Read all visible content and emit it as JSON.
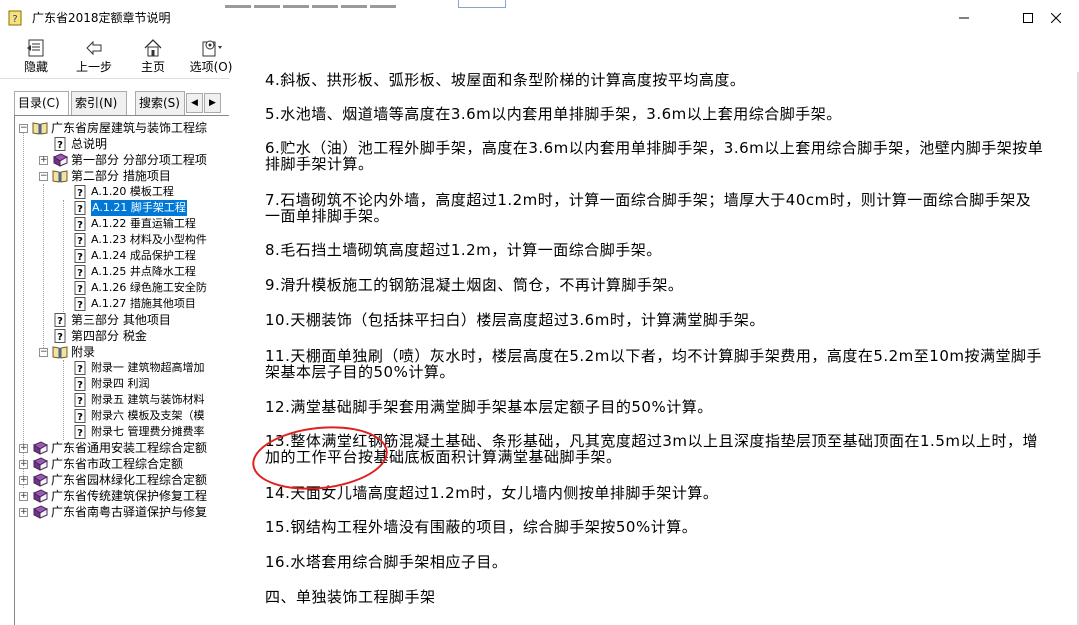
{
  "window": {
    "title": "广东省2018定额章节说明",
    "controls": {
      "minimize": "—",
      "maximize": "☐",
      "close": "✕"
    }
  },
  "toolbar": {
    "buttons": [
      {
        "label": "隐藏",
        "icon": "hide-panel-icon"
      },
      {
        "label": "上一步",
        "icon": "back-arrow-icon"
      },
      {
        "label": "主页",
        "icon": "home-icon"
      },
      {
        "label": "选项(O)",
        "icon": "options-icon"
      }
    ]
  },
  "tabs": [
    {
      "label": "目录(C)",
      "active": true
    },
    {
      "label": "索引(N)",
      "active": false
    },
    {
      "label": "搜索(S)",
      "active": false
    }
  ],
  "tree": [
    {
      "label": "广东省房屋建筑与装饰工程综",
      "expander": "−",
      "icon": "open-book-icon"
    },
    {
      "label": "总说明",
      "icon": "help-page-icon"
    },
    {
      "label": "第一部分 分部分项工程项",
      "expander": "+",
      "icon": "closed-book-icon"
    },
    {
      "label": "第二部分 措施项目",
      "expander": "−",
      "icon": "open-book-icon"
    },
    {
      "label": "A.1.20 模板工程",
      "icon": "help-page-icon"
    },
    {
      "label": "A.1.21 脚手架工程",
      "icon": "help-page-icon",
      "selected": true
    },
    {
      "label": "A.1.22 垂直运输工程",
      "icon": "help-page-icon"
    },
    {
      "label": "A.1.23 材料及小型构件",
      "icon": "help-page-icon"
    },
    {
      "label": "A.1.24 成品保护工程",
      "icon": "help-page-icon"
    },
    {
      "label": "A.1.25 井点降水工程",
      "icon": "help-page-icon"
    },
    {
      "label": "A.1.26 绿色施工安全防",
      "icon": "help-page-icon"
    },
    {
      "label": "A.1.27 措施其他项目",
      "icon": "help-page-icon"
    },
    {
      "label": "第三部分 其他项目",
      "icon": "help-page-icon"
    },
    {
      "label": "第四部分 税金",
      "icon": "help-page-icon"
    },
    {
      "label": "附录",
      "expander": "−",
      "icon": "open-book-icon"
    },
    {
      "label": "附录一 建筑物超高增加",
      "icon": "help-page-icon"
    },
    {
      "label": "附录四 利润",
      "icon": "help-page-icon"
    },
    {
      "label": "附录五 建筑与装饰材料",
      "icon": "help-page-icon"
    },
    {
      "label": "附录六 模板及支架（模",
      "icon": "help-page-icon"
    },
    {
      "label": "附录七 管理费分摊费率",
      "icon": "help-page-icon"
    },
    {
      "label": "广东省通用安装工程综合定额",
      "expander": "+",
      "icon": "closed-book-icon"
    },
    {
      "label": "广东省市政工程综合定额",
      "expander": "+",
      "icon": "closed-book-icon"
    },
    {
      "label": "广东省园林绿化工程综合定额",
      "expander": "+",
      "icon": "closed-book-icon"
    },
    {
      "label": "广东省传统建筑保护修复工程",
      "expander": "+",
      "icon": "closed-book-icon"
    },
    {
      "label": "广东省南粤古驿道保护与修复",
      "expander": "+",
      "icon": "closed-book-icon"
    }
  ],
  "content": {
    "paragraphs": [
      "4.斜板、拱形板、弧形板、坡屋面和条型阶梯的计算高度按平均高度。",
      "5.水池墙、烟道墙等高度在3.6m以内套用单排脚手架，3.6m以上套用综合脚手架。",
      "6.贮水（油）池工程外脚手架，高度在3.6m以内套用单排脚手架，3.6m以上套用综合脚手架，池壁内脚手架按单排脚手架计算。",
      "7.石墙砌筑不论内外墙，高度超过1.2m时，计算一面综合脚手架；墙厚大于40cm时，则计算一面综合脚手架及一面单排脚手架。",
      "8.毛石挡土墙砌筑高度超过1.2m，计算一面综合脚手架。",
      "9.滑升模板施工的钢筋混凝土烟囱、筒仓，不再计算脚手架。",
      "10.天棚装饰（包括抹平扫白）楼层高度超过3.6m时，计算满堂脚手架。",
      "11.天棚面单独刷（喷）灰水时，楼层高度在5.2m以下者，均不计算脚手架费用，高度在5.2m至10m按满堂脚手架基本层子目的50%计算。",
      "12.满堂基础脚手架套用满堂脚手架基本层定额子目的50%计算。",
      "13.整体满堂红钢筋混凝土基础、条形基础，凡其宽度超过3m以上且深度指垫层顶至基础顶面在1.5m以上时，增加的工作平台按基础底板面积计算满堂基础脚手架。",
      "14.天面女儿墙高度超过1.2m时，女儿墙内侧按单排脚手架计算。",
      "15.钢结构工程外墙没有围蔽的项目，综合脚手架按50%计算。",
      "16.水塔套用综合脚手架相应子目。",
      "四、单独装饰工程脚手架"
    ]
  },
  "colors": {
    "selection": "#0078d7",
    "annotation": "#e02020"
  }
}
